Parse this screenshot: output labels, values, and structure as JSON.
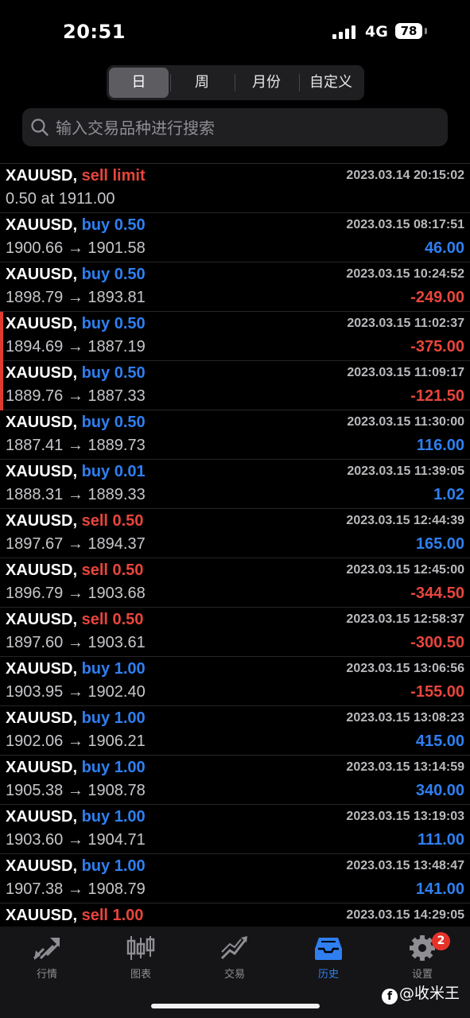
{
  "status": {
    "time": "20:51",
    "network": "4G",
    "battery": "78"
  },
  "period_tabs": [
    {
      "label": "日",
      "active": true
    },
    {
      "label": "周",
      "active": false
    },
    {
      "label": "月份",
      "active": false
    },
    {
      "label": "自定义",
      "active": false
    }
  ],
  "search": {
    "placeholder": "输入交易品种进行搜索",
    "value": ""
  },
  "orders": [
    {
      "symbol": "XAUUSD,",
      "type": "sell limit",
      "side": "sell",
      "time": "2023.03.14 20:15:02",
      "prices": "0.50 at 1911.00",
      "profit": "",
      "flag": false
    },
    {
      "symbol": "XAUUSD,",
      "type": "buy 0.50",
      "side": "buy",
      "time": "2023.03.15 08:17:51",
      "prices": "1900.66 → 1901.58",
      "profit": "46.00",
      "flag": false
    },
    {
      "symbol": "XAUUSD,",
      "type": "buy 0.50",
      "side": "buy",
      "time": "2023.03.15 10:24:52",
      "prices": "1898.79 → 1893.81",
      "profit": "-249.00",
      "flag": false
    },
    {
      "symbol": "XAUUSD,",
      "type": "buy 0.50",
      "side": "buy",
      "time": "2023.03.15 11:02:37",
      "prices": "1894.69 → 1887.19",
      "profit": "-375.00",
      "flag": true
    },
    {
      "symbol": "XAUUSD,",
      "type": "buy 0.50",
      "side": "buy",
      "time": "2023.03.15 11:09:17",
      "prices": "1889.76 → 1887.33",
      "profit": "-121.50",
      "flag": true
    },
    {
      "symbol": "XAUUSD,",
      "type": "buy 0.50",
      "side": "buy",
      "time": "2023.03.15 11:30:00",
      "prices": "1887.41 → 1889.73",
      "profit": "116.00",
      "flag": false
    },
    {
      "symbol": "XAUUSD,",
      "type": "buy 0.01",
      "side": "buy",
      "time": "2023.03.15 11:39:05",
      "prices": "1888.31 → 1889.33",
      "profit": "1.02",
      "flag": false
    },
    {
      "symbol": "XAUUSD,",
      "type": "sell 0.50",
      "side": "sell",
      "time": "2023.03.15 12:44:39",
      "prices": "1897.67 → 1894.37",
      "profit": "165.00",
      "flag": false
    },
    {
      "symbol": "XAUUSD,",
      "type": "sell 0.50",
      "side": "sell",
      "time": "2023.03.15 12:45:00",
      "prices": "1896.79 → 1903.68",
      "profit": "-344.50",
      "flag": false
    },
    {
      "symbol": "XAUUSD,",
      "type": "sell 0.50",
      "side": "sell",
      "time": "2023.03.15 12:58:37",
      "prices": "1897.60 → 1903.61",
      "profit": "-300.50",
      "flag": false
    },
    {
      "symbol": "XAUUSD,",
      "type": "buy 1.00",
      "side": "buy",
      "time": "2023.03.15 13:06:56",
      "prices": "1903.95 → 1902.40",
      "profit": "-155.00",
      "flag": false
    },
    {
      "symbol": "XAUUSD,",
      "type": "buy 1.00",
      "side": "buy",
      "time": "2023.03.15 13:08:23",
      "prices": "1902.06 → 1906.21",
      "profit": "415.00",
      "flag": false
    },
    {
      "symbol": "XAUUSD,",
      "type": "buy 1.00",
      "side": "buy",
      "time": "2023.03.15 13:14:59",
      "prices": "1905.38 → 1908.78",
      "profit": "340.00",
      "flag": false
    },
    {
      "symbol": "XAUUSD,",
      "type": "buy 1.00",
      "side": "buy",
      "time": "2023.03.15 13:19:03",
      "prices": "1903.60 → 1904.71",
      "profit": "111.00",
      "flag": false
    },
    {
      "symbol": "XAUUSD,",
      "type": "buy 1.00",
      "side": "buy",
      "time": "2023.03.15 13:48:47",
      "prices": "1907.38 → 1908.79",
      "profit": "141.00",
      "flag": false
    },
    {
      "symbol": "XAUUSD,",
      "type": "sell 1.00",
      "side": "sell",
      "time": "2023.03.15 14:29:05",
      "prices": "",
      "profit": "",
      "flag": false
    }
  ],
  "tabbar": [
    {
      "label": "行情",
      "icon": "quotes-arrows-icon",
      "active": false
    },
    {
      "label": "图表",
      "icon": "candlestick-chart-icon",
      "active": false
    },
    {
      "label": "交易",
      "icon": "trade-line-icon",
      "active": false
    },
    {
      "label": "历史",
      "icon": "history-tray-icon",
      "active": true
    },
    {
      "label": "设置",
      "icon": "gear-icon",
      "active": false
    }
  ],
  "settings_badge": "2",
  "watermark": "@收米王",
  "colors": {
    "buy": "#2f7ff0",
    "sell": "#e8453c",
    "profit_positive": "#2f7ff0",
    "profit_negative": "#e8453c",
    "active_tab": "#2f7ff0",
    "badge": "#e5332a"
  }
}
